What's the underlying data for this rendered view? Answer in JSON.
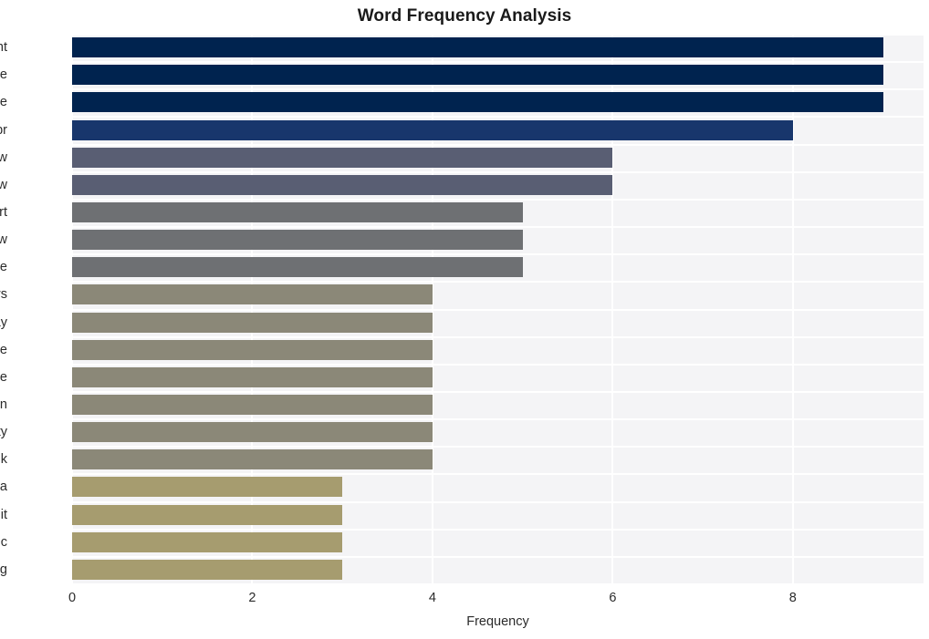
{
  "chart_data": {
    "type": "bar",
    "orientation": "horizontal",
    "title": "Word Frequency Analysis",
    "xlabel": "Frequency",
    "ylabel": "",
    "categories": [
      "want",
      "image",
      "people",
      "npr",
      "new",
      "know",
      "start",
      "law",
      "rule",
      "users",
      "day",
      "enlarge",
      "toggle",
      "caption",
      "getty",
      "think",
      "alabama",
      "reddit",
      "public",
      "morning"
    ],
    "values": [
      9,
      9,
      9,
      8,
      6,
      6,
      5,
      5,
      5,
      4,
      4,
      4,
      4,
      4,
      4,
      4,
      3,
      3,
      3,
      3
    ],
    "bar_colors": [
      "#00234f",
      "#00234f",
      "#00234f",
      "#18366c",
      "#595e73",
      "#595e73",
      "#6e7073",
      "#6e7073",
      "#6e7073",
      "#8b8878",
      "#8b8878",
      "#8b8878",
      "#8b8878",
      "#8b8878",
      "#8b8878",
      "#8b8878",
      "#a69c6f",
      "#a69c6f",
      "#a69c6f",
      "#a69c6f"
    ],
    "xticks": [
      0,
      2,
      4,
      6,
      8
    ],
    "xlim": [
      0,
      9.45
    ],
    "grid": true,
    "gridlines": "vertical-and-horizontal",
    "legend": null,
    "plot_background": "#f4f4f6",
    "grid_color": "#ffffff",
    "figure_background": "#ffffff"
  }
}
